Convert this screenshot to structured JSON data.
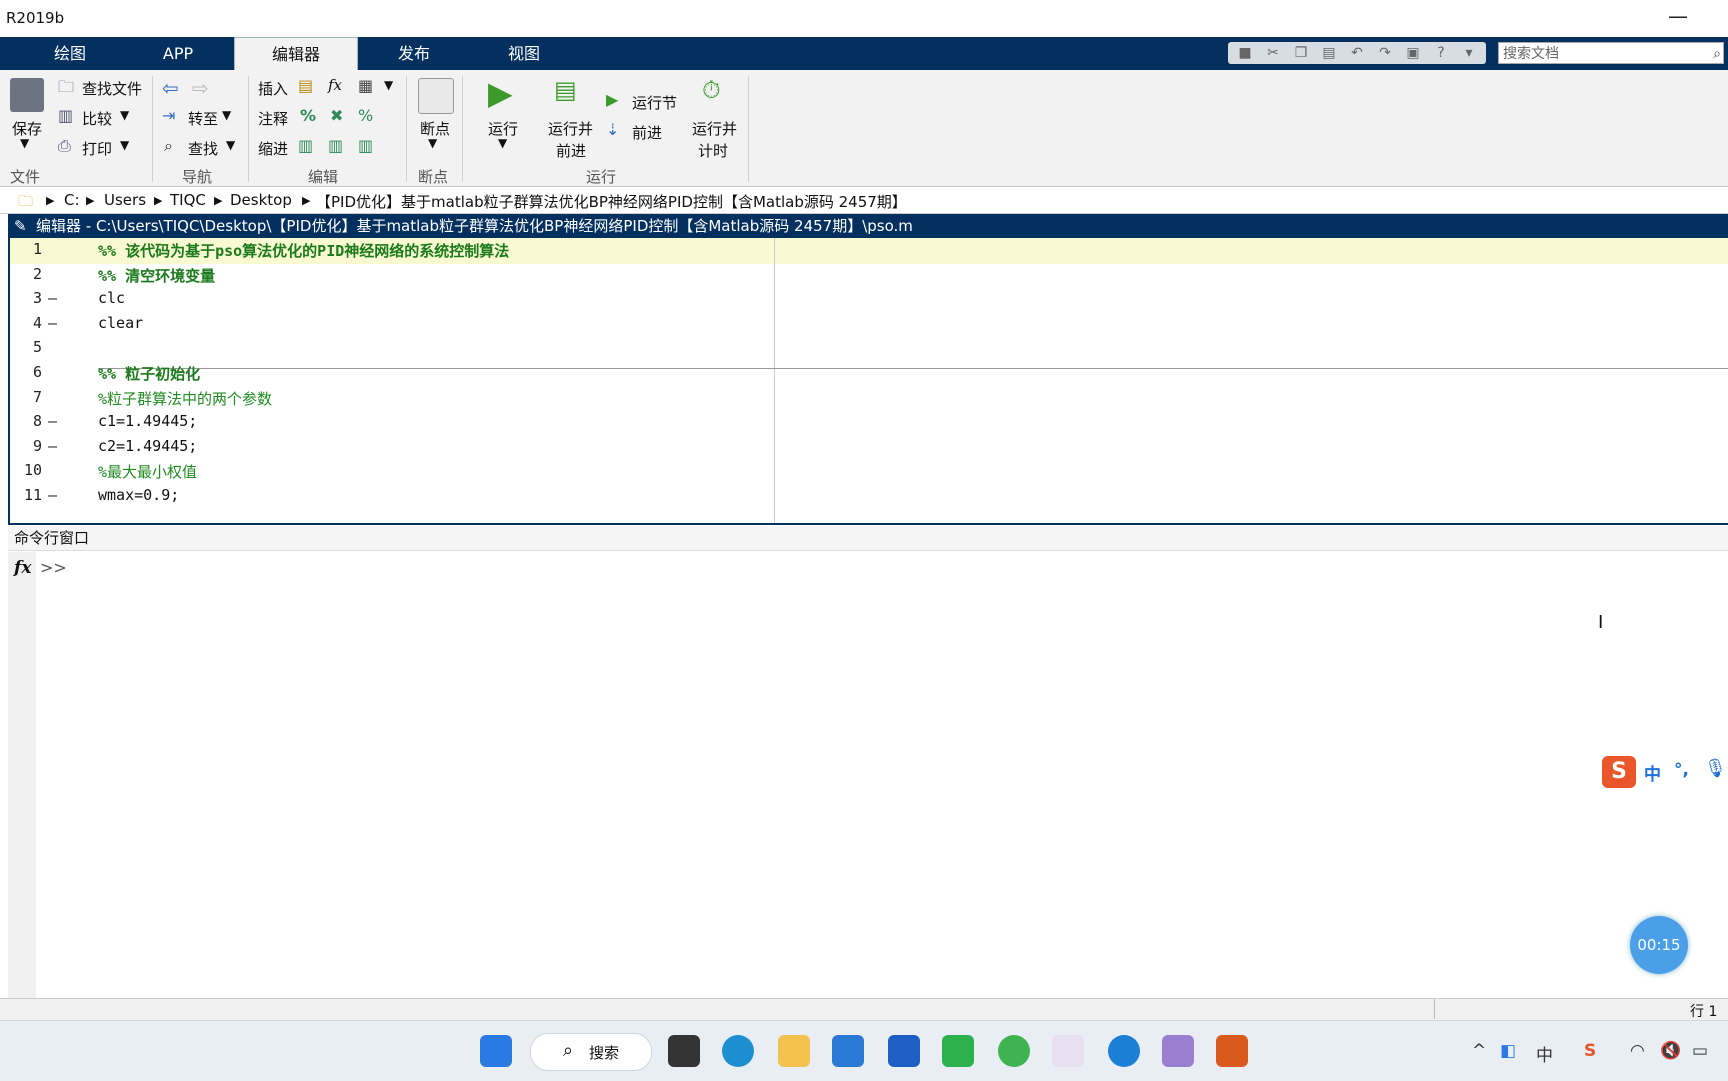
{
  "window": {
    "title": "R2019b",
    "minimize": "—"
  },
  "tabs": [
    "绘图",
    "APP",
    "编辑器",
    "发布",
    "视图"
  ],
  "search": {
    "placeholder": "搜索文档"
  },
  "toolstrip": {
    "file": {
      "save": "保存",
      "find_files": "查找文件",
      "compare": "比较",
      "print": "打印",
      "group": "文件"
    },
    "navigate": {
      "goto": "转至",
      "find": "查找",
      "group": "导航"
    },
    "edit": {
      "insert": "插入",
      "comment": "注释",
      "indent": "缩进",
      "fx": "fx",
      "group": "编辑"
    },
    "breakpoints": {
      "label": "断点",
      "group": "断点"
    },
    "run": {
      "run": "运行",
      "run_advance_1": "运行并",
      "run_advance_2": "前进",
      "run_section": "运行节",
      "advance": "前进",
      "run_time_1": "运行并",
      "run_time_2": "计时",
      "group": "运行"
    }
  },
  "address": [
    "C:",
    "Users",
    "TIQC",
    "Desktop",
    "【PID优化】基于matlab粒子群算法优化BP神经网络PID控制【含Matlab源码 2457期】"
  ],
  "editor": {
    "title": "编辑器 - C:\\Users\\TIQC\\Desktop\\【PID优化】基于matlab粒子群算法优化BP神经网络PID控制【含Matlab源码 2457期】\\pso.m",
    "lines": [
      {
        "num": "1",
        "dash": "",
        "text": "%% 该代码为基于pso算法优化的PID神经网络的系统控制算法",
        "kind": "cell"
      },
      {
        "num": "2",
        "dash": "",
        "text": "%% 清空环境变量",
        "kind": "cell"
      },
      {
        "num": "3",
        "dash": "—",
        "text": "clc",
        "kind": "code"
      },
      {
        "num": "4",
        "dash": "—",
        "text": "clear",
        "kind": "code"
      },
      {
        "num": "5",
        "dash": "",
        "text": "",
        "kind": "code"
      },
      {
        "num": "6",
        "dash": "",
        "text": "%% 粒子初始化",
        "kind": "cell"
      },
      {
        "num": "7",
        "dash": "",
        "text": "%粒子群算法中的两个参数",
        "kind": "cmt"
      },
      {
        "num": "8",
        "dash": "—",
        "text": "c1=1.49445;",
        "kind": "code"
      },
      {
        "num": "9",
        "dash": "—",
        "text": "c2=1.49445;",
        "kind": "code"
      },
      {
        "num": "10",
        "dash": "",
        "text": "%最大最小权值",
        "kind": "cmt"
      },
      {
        "num": "11",
        "dash": "—",
        "text": "wmax=0.9;",
        "kind": "code"
      }
    ]
  },
  "command": {
    "label": "命令行窗口",
    "fx": "fx",
    "prompt": ">>"
  },
  "ime": {
    "label": "中",
    "punct": "°,"
  },
  "timer": "00:15",
  "status": {
    "row": "行 1"
  },
  "taskbar": {
    "search": "搜索"
  }
}
